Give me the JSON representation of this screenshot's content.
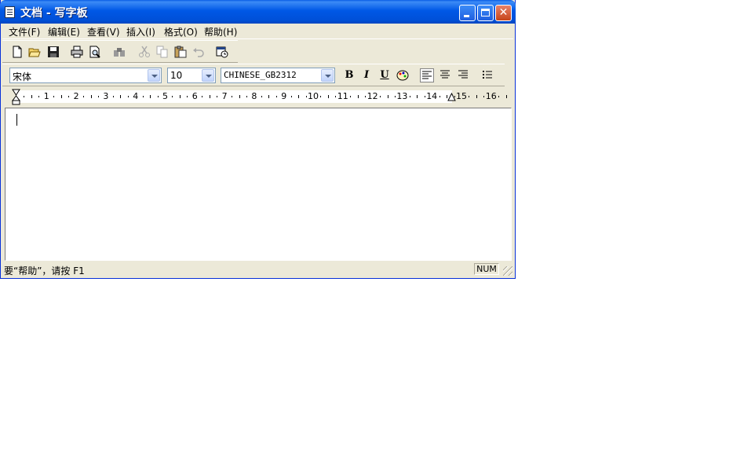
{
  "window": {
    "title": "文档 - 写字板"
  },
  "menu": [
    {
      "label": "文件(F)",
      "key": "F"
    },
    {
      "label": "编辑(E)",
      "key": "E"
    },
    {
      "label": "查看(V)",
      "key": "V"
    },
    {
      "label": "插入(I)",
      "key": "I"
    },
    {
      "label": "格式(O)",
      "key": "O"
    },
    {
      "label": "帮助(H)",
      "key": "H"
    }
  ],
  "format_bar": {
    "font_name": "宋体",
    "font_size": "10",
    "script": "CHINESE_GB2312",
    "bold": "B",
    "italic": "I",
    "underline": "U"
  },
  "ruler": {
    "numbers": [
      "1",
      "2",
      "3",
      "4",
      "5",
      "6",
      "7",
      "8",
      "9",
      "10",
      "11",
      "12",
      "13",
      "14",
      "15",
      "16"
    ]
  },
  "status": {
    "help_text": "要“帮助”，请按 F1",
    "num": "NUM"
  },
  "colors": {
    "titlebar": "#0058e6",
    "face": "#ece9d8",
    "close_button": "#c64419"
  }
}
